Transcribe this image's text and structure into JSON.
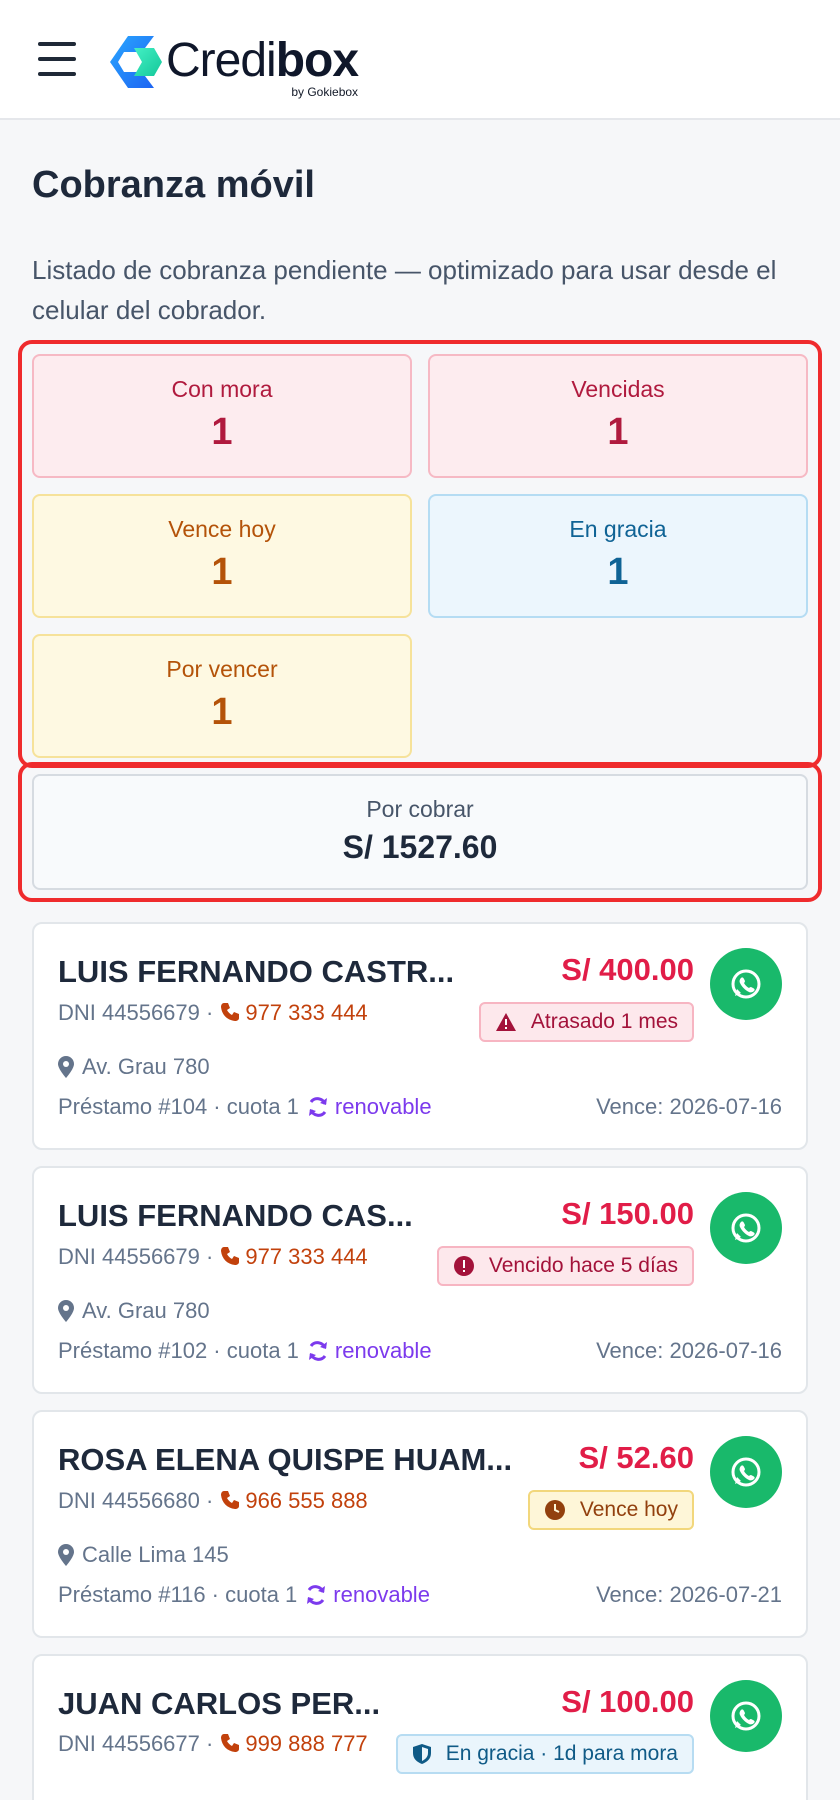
{
  "header": {
    "brand_light": "Credi",
    "brand_bold": "box",
    "brand_by": "by Gokiebox"
  },
  "page": {
    "title": "Cobranza móvil",
    "subtitle": "Listado de cobranza pendiente — optimizado para usar desde el celular del cobrador."
  },
  "summary": {
    "con_mora": {
      "label": "Con mora",
      "value": "1"
    },
    "vencidas": {
      "label": "Vencidas",
      "value": "1"
    },
    "vence_hoy": {
      "label": "Vence hoy",
      "value": "1"
    },
    "en_gracia": {
      "label": "En gracia",
      "value": "1"
    },
    "por_vencer": {
      "label": "Por vencer",
      "value": "1"
    },
    "por_cobrar": {
      "label": "Por cobrar",
      "value": "S/ 1527.60"
    }
  },
  "colors": {
    "danger": "#e11d48",
    "warning": "#b45309",
    "info": "#0f6395",
    "whatsapp": "#19b96b",
    "renovable": "#7c3aed"
  },
  "cards": [
    {
      "name": "LUIS FERNANDO CASTR...",
      "amount": "S/ 400.00",
      "dni": "DNI 44556679 ·",
      "phone": "977 333 444",
      "badge": "Atrasado 1 mes",
      "badge_icon": "warning-icon",
      "address": "Av. Grau 780",
      "loan": "Préstamo #104 · cuota 1",
      "renovable": "renovable",
      "due": "Vence: 2026-07-16"
    },
    {
      "name": "LUIS FERNANDO CAS...",
      "amount": "S/ 150.00",
      "dni": "DNI 44556679 ·",
      "phone": "977 333 444",
      "badge": "Vencido hace 5 días",
      "badge_icon": "exclamation-circle-icon",
      "address": "Av. Grau 780",
      "loan": "Préstamo #102 · cuota 1",
      "renovable": "renovable",
      "due": "Vence: 2026-07-16"
    },
    {
      "name": "ROSA ELENA QUISPE HUAM...",
      "amount": "S/ 52.60",
      "dni": "DNI 44556680 ·",
      "phone": "966 555 888",
      "badge": "Vence hoy",
      "badge_icon": "clock-icon",
      "address": "Calle Lima 145",
      "loan": "Préstamo #116 · cuota 1",
      "renovable": "renovable",
      "due": "Vence: 2026-07-21"
    },
    {
      "name": "JUAN CARLOS PER...",
      "amount": "S/ 100.00",
      "dni": "DNI 44556677 ·",
      "phone": "999 888 777",
      "badge": "En gracia · 1d para mora",
      "badge_icon": "shield-icon"
    }
  ]
}
